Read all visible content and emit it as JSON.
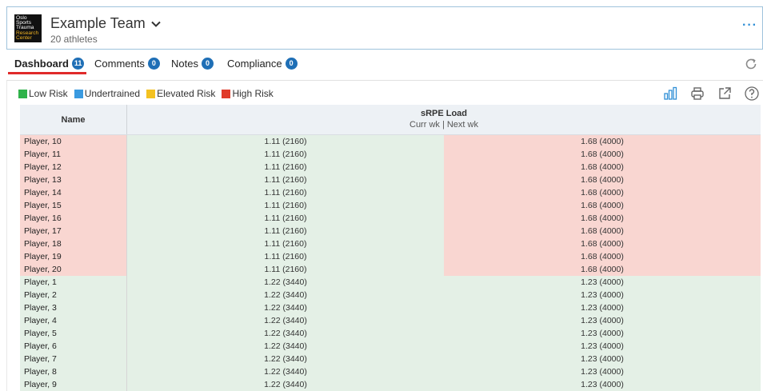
{
  "header": {
    "logo_lines": [
      "Oslo",
      "Sports",
      "Trauma",
      "Research",
      "Center"
    ],
    "team_name": "Example Team",
    "athlete_count": "20 athletes",
    "more_label": "···"
  },
  "tabs": [
    {
      "label": "Dashboard",
      "count": "11",
      "active": true
    },
    {
      "label": "Comments",
      "count": "0"
    },
    {
      "label": "Notes",
      "count": "0"
    },
    {
      "label": "Compliance",
      "count": "0"
    }
  ],
  "legend": [
    {
      "label": "Low Risk",
      "color": "#2fb24a"
    },
    {
      "label": "Undertrained",
      "color": "#3a9ae0"
    },
    {
      "label": "Elevated Risk",
      "color": "#f4c221"
    },
    {
      "label": "High Risk",
      "color": "#e03b2a"
    }
  ],
  "table": {
    "col_name": "Name",
    "col_load_title": "sRPE Load",
    "col_load_sub": "Curr wk | Next wk",
    "rows": [
      {
        "name": "Player, 10",
        "curr": "1.11 (2160)",
        "next": "1.68 (4000)",
        "risk_name": "high",
        "risk_curr": "low",
        "risk_next": "high"
      },
      {
        "name": "Player, 11",
        "curr": "1.11 (2160)",
        "next": "1.68 (4000)",
        "risk_name": "high",
        "risk_curr": "low",
        "risk_next": "high"
      },
      {
        "name": "Player, 12",
        "curr": "1.11 (2160)",
        "next": "1.68 (4000)",
        "risk_name": "high",
        "risk_curr": "low",
        "risk_next": "high"
      },
      {
        "name": "Player, 13",
        "curr": "1.11 (2160)",
        "next": "1.68 (4000)",
        "risk_name": "high",
        "risk_curr": "low",
        "risk_next": "high"
      },
      {
        "name": "Player, 14",
        "curr": "1.11 (2160)",
        "next": "1.68 (4000)",
        "risk_name": "high",
        "risk_curr": "low",
        "risk_next": "high"
      },
      {
        "name": "Player, 15",
        "curr": "1.11 (2160)",
        "next": "1.68 (4000)",
        "risk_name": "high",
        "risk_curr": "low",
        "risk_next": "high"
      },
      {
        "name": "Player, 16",
        "curr": "1.11 (2160)",
        "next": "1.68 (4000)",
        "risk_name": "high",
        "risk_curr": "low",
        "risk_next": "high"
      },
      {
        "name": "Player, 17",
        "curr": "1.11 (2160)",
        "next": "1.68 (4000)",
        "risk_name": "high",
        "risk_curr": "low",
        "risk_next": "high"
      },
      {
        "name": "Player, 18",
        "curr": "1.11 (2160)",
        "next": "1.68 (4000)",
        "risk_name": "high",
        "risk_curr": "low",
        "risk_next": "high"
      },
      {
        "name": "Player, 19",
        "curr": "1.11 (2160)",
        "next": "1.68 (4000)",
        "risk_name": "high",
        "risk_curr": "low",
        "risk_next": "high"
      },
      {
        "name": "Player, 20",
        "curr": "1.11 (2160)",
        "next": "1.68 (4000)",
        "risk_name": "high",
        "risk_curr": "low",
        "risk_next": "high"
      },
      {
        "name": "Player, 1",
        "curr": "1.22 (3440)",
        "next": "1.23 (4000)",
        "risk_name": "low",
        "risk_curr": "low",
        "risk_next": "low"
      },
      {
        "name": "Player, 2",
        "curr": "1.22 (3440)",
        "next": "1.23 (4000)",
        "risk_name": "low",
        "risk_curr": "low",
        "risk_next": "low"
      },
      {
        "name": "Player, 3",
        "curr": "1.22 (3440)",
        "next": "1.23 (4000)",
        "risk_name": "low",
        "risk_curr": "low",
        "risk_next": "low"
      },
      {
        "name": "Player, 4",
        "curr": "1.22 (3440)",
        "next": "1.23 (4000)",
        "risk_name": "low",
        "risk_curr": "low",
        "risk_next": "low"
      },
      {
        "name": "Player, 5",
        "curr": "1.22 (3440)",
        "next": "1.23 (4000)",
        "risk_name": "low",
        "risk_curr": "low",
        "risk_next": "low"
      },
      {
        "name": "Player, 6",
        "curr": "1.22 (3440)",
        "next": "1.23 (4000)",
        "risk_name": "low",
        "risk_curr": "low",
        "risk_next": "low"
      },
      {
        "name": "Player, 7",
        "curr": "1.22 (3440)",
        "next": "1.23 (4000)",
        "risk_name": "low",
        "risk_curr": "low",
        "risk_next": "low"
      },
      {
        "name": "Player, 8",
        "curr": "1.22 (3440)",
        "next": "1.23 (4000)",
        "risk_name": "low",
        "risk_curr": "low",
        "risk_next": "low"
      },
      {
        "name": "Player, 9",
        "curr": "1.22 (3440)",
        "next": "1.23 (4000)",
        "risk_name": "low",
        "risk_curr": "low",
        "risk_next": "low"
      }
    ]
  },
  "icons": [
    "chart-icon",
    "print-icon",
    "export-icon",
    "help-icon",
    "refresh-icon",
    "chevron-down-icon"
  ]
}
